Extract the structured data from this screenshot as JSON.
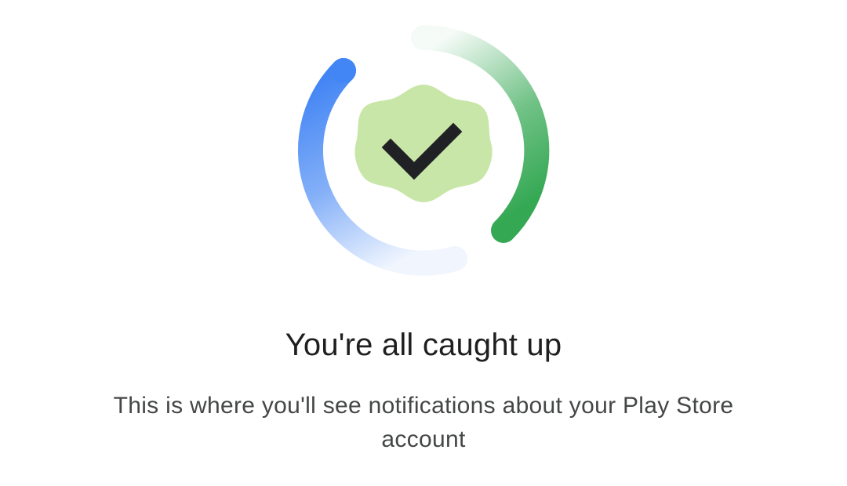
{
  "empty_state": {
    "illustration_icon": "check-badge-icon",
    "title": "You're all caught up",
    "message": "This is where you'll see notifications about your Play Store account"
  },
  "colors": {
    "ring_blue": "#4285f4",
    "ring_green": "#34a853",
    "badge_fill": "#c8e6a8",
    "check_mark": "#202124",
    "title_text": "#1f1f1f",
    "body_text": "#444746"
  }
}
